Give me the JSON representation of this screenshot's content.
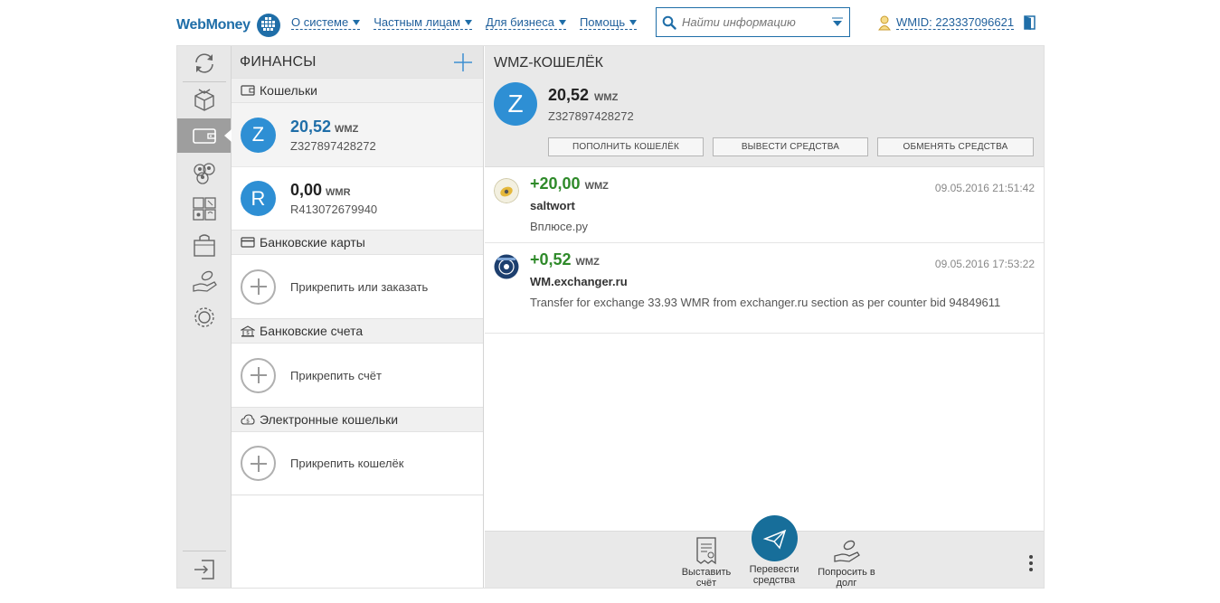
{
  "header": {
    "logo_text": "WebMoney",
    "nav": [
      {
        "label": "О системе"
      },
      {
        "label": "Частным лицам"
      },
      {
        "label": "Для бизнеса"
      },
      {
        "label": "Помощь"
      }
    ],
    "search_placeholder": "Найти информацию",
    "wmid_label": "WMID: 223337096621"
  },
  "finance": {
    "title": "ФИНАНСЫ",
    "sections": {
      "purses": "Кошельки",
      "cards": "Банковские карты",
      "accounts": "Банковские счета",
      "ewallets": "Электронные кошельки"
    },
    "purses": [
      {
        "letter": "Z",
        "amount": "20,52",
        "currency": "WMZ",
        "number": "Z327897428272"
      },
      {
        "letter": "R",
        "amount": "0,00",
        "currency": "WMR",
        "number": "R413072679940"
      }
    ],
    "attach_card": "Прикрепить или заказать",
    "attach_account": "Прикрепить счёт",
    "attach_wallet": "Прикрепить кошелёк"
  },
  "wallet": {
    "title": "WMZ-КОШЕЛЁК",
    "letter": "Z",
    "amount": "20,52",
    "currency": "WMZ",
    "number": "Z327897428272",
    "buttons": {
      "topup": "ПОПОЛНИТЬ КОШЕЛЁК",
      "withdraw": "ВЫВЕСТИ СРЕДСТВА",
      "exchange": "ОБМЕНЯТЬ СРЕДСТВА"
    },
    "transactions": [
      {
        "amount": "+20,00",
        "currency": "WMZ",
        "date": "09.05.2016 21:51:42",
        "name": "saltwort",
        "desc": "Вплюсе.ру"
      },
      {
        "amount": "+0,52",
        "currency": "WMZ",
        "date": "09.05.2016 17:53:22",
        "name": "WM.exchanger.ru",
        "desc": "Transfer for exchange 33.93 WMR from exchanger.ru section as per counter bid 94849611"
      }
    ],
    "actions": {
      "invoice_1": "Выставить",
      "invoice_2": "счёт",
      "send_1": "Перевести",
      "send_2": "средства",
      "loan_1": "Попросить в",
      "loan_2": "долг"
    }
  },
  "colors": {
    "brand": "#1f6ea8",
    "avatar": "#2e8fd4",
    "positive": "#2f8a2a",
    "send_button": "#176e9a"
  }
}
